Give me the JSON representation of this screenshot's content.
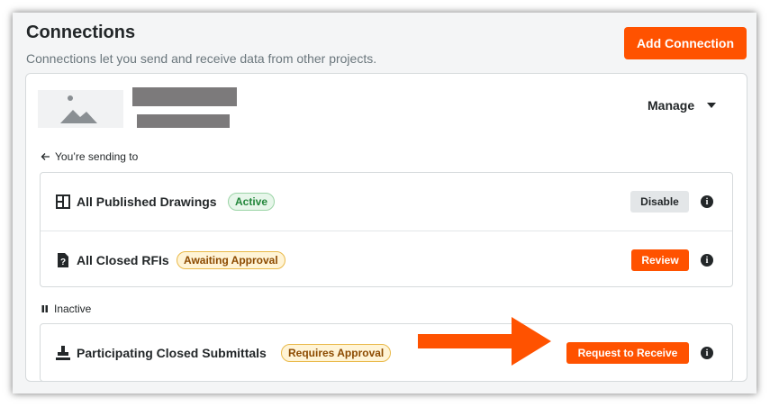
{
  "header": {
    "title": "Connections",
    "subtitle": "Connections let you send and receive data from other projects.",
    "add_button": "Add Connection"
  },
  "project": {
    "thumbnail_icon": "image-placeholder-icon",
    "manage_label": "Manage"
  },
  "sending": {
    "label": "You’re sending to",
    "icon": "arrow-left-icon",
    "items": [
      {
        "title": "All Published Drawings",
        "icon": "drawings-icon",
        "badge": "Active",
        "action": "Disable"
      },
      {
        "title": "All Closed RFIs",
        "icon": "rfi-question-icon",
        "badge": "Awaiting Approval",
        "action": "Review"
      }
    ]
  },
  "inactive": {
    "label": "Inactive",
    "icon": "pause-icon",
    "items": [
      {
        "title": "Participating Closed Submittals",
        "icon": "submittal-stamp-icon",
        "badge": "Requires Approval",
        "action": "Request to Receive"
      }
    ]
  },
  "colors": {
    "accent": "#ff5200",
    "active_badge": "#22863a",
    "warning_badge": "#e9b949"
  }
}
